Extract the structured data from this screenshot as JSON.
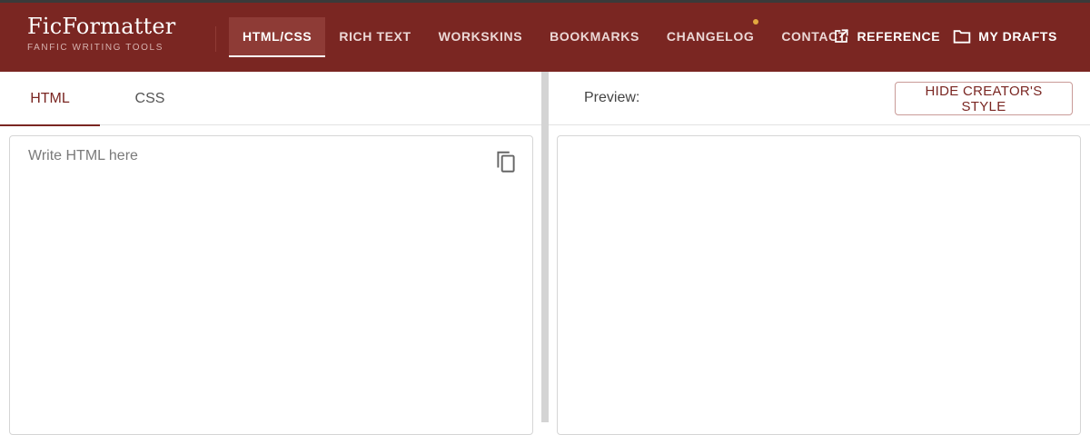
{
  "brand": {
    "title": "FicFormatter",
    "subtitle": "FANFIC WRITING TOOLS"
  },
  "nav": {
    "items": [
      {
        "label": "HTML/CSS",
        "active": true
      },
      {
        "label": "RICH TEXT"
      },
      {
        "label": "WORKSKINS"
      },
      {
        "label": "BOOKMARKS"
      },
      {
        "label": "CHANGELOG",
        "notification": true
      },
      {
        "label": "CONTACT"
      }
    ],
    "reference_label": "REFERENCE",
    "drafts_label": "MY DRAFTS"
  },
  "editor": {
    "tabs": [
      {
        "label": "HTML",
        "active": true
      },
      {
        "label": "CSS"
      }
    ],
    "placeholder": "Write HTML here",
    "value": ""
  },
  "preview": {
    "label": "Preview:",
    "hide_style_button": "HIDE CREATOR'S STYLE"
  },
  "colors": {
    "brand": "#7a2622",
    "active_tab_bg": "#8e3b36",
    "notification_dot": "#e3a83f"
  }
}
